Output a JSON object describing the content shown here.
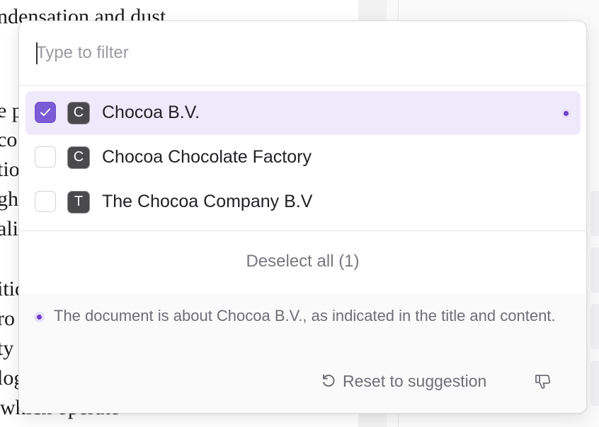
{
  "document": {
    "lines": [
      "ndensation and dust",
      "e p",
      "co",
      "tio",
      "gh",
      "ali",
      "itio",
      "ro",
      "ty",
      "log",
      "which operate"
    ]
  },
  "filter": {
    "placeholder": "Type to filter",
    "value": ""
  },
  "options": [
    {
      "label": "Chocoa B.V.",
      "avatar": "C",
      "checked": true,
      "suggested": true
    },
    {
      "label": "Chocoa Chocolate Factory",
      "avatar": "C",
      "checked": false,
      "suggested": false
    },
    {
      "label": "The Chocoa Company B.V",
      "avatar": "T",
      "checked": false,
      "suggested": false
    }
  ],
  "deselect_label": "Deselect all (1)",
  "suggestion": {
    "reason": "The document is about Chocoa B.V., as indicated in the title and content.",
    "reset_label": "Reset to suggestion",
    "reset_icon": "undo-icon",
    "feedback_icon": "thumbs-down-icon"
  },
  "colors": {
    "accent": "#7b5cd6",
    "selected_row": "#efeafb",
    "suggest_dot": "#6b3fc7",
    "avatar": "#4a4a4d"
  }
}
